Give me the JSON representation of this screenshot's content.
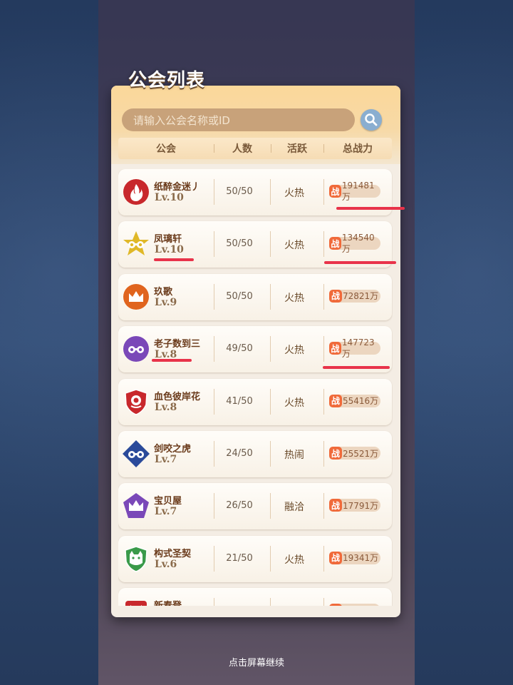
{
  "title": "公会列表",
  "search": {
    "placeholder": "请输入公会名称或ID"
  },
  "headers": {
    "guild": "公会",
    "members": "人数",
    "activity": "活跃",
    "power": "总战力"
  },
  "power_badge": "战",
  "guilds": [
    {
      "name": "纸醉金迷丿",
      "level": "Lv.10",
      "members": "50/50",
      "activity": "火热",
      "power": "191481万",
      "emblem": "flame-emblem-icon",
      "color": "#c8282c"
    },
    {
      "name": "凤璃轩",
      "level": "Lv.10",
      "members": "50/50",
      "activity": "火热",
      "power": "134540万",
      "emblem": "goggles-star-emblem-icon",
      "color": "#e0b828"
    },
    {
      "name": "玖歌",
      "level": "Lv.9",
      "members": "50/50",
      "activity": "火热",
      "power": "72821万",
      "emblem": "crown-emblem-icon",
      "color": "#e0641e"
    },
    {
      "name": "老子数到三",
      "level": "Lv.8",
      "members": "49/50",
      "activity": "火热",
      "power": "147723万",
      "emblem": "goggles-emblem-icon",
      "color": "#7a48b8"
    },
    {
      "name": "血色彼岸花",
      "level": "Lv.8",
      "members": "41/50",
      "activity": "火热",
      "power": "55416万",
      "emblem": "rose-shield-emblem-icon",
      "color": "#c8282c"
    },
    {
      "name": "剑咬之虎",
      "level": "Lv.7",
      "members": "24/50",
      "activity": "热闹",
      "power": "25521万",
      "emblem": "goggles-diamond-emblem-icon",
      "color": "#2a4a9a"
    },
    {
      "name": "宝贝屋",
      "level": "Lv.7",
      "members": "26/50",
      "activity": "融洽",
      "power": "17791万",
      "emblem": "crown-pentagon-emblem-icon",
      "color": "#7a48b8"
    },
    {
      "name": "构式圣契",
      "level": "Lv.6",
      "members": "21/50",
      "activity": "火热",
      "power": "19341万",
      "emblem": "cat-shield-emblem-icon",
      "color": "#3a9a4a"
    },
    {
      "name": "新春登",
      "level": "",
      "members": "",
      "activity": "",
      "power": "",
      "emblem": "ribbon-emblem-icon",
      "color": "#c8282c"
    }
  ],
  "footer_hint": "点击屏幕继续",
  "colors": {
    "accent": "#f06a3a",
    "annotation": "#e8334a",
    "panel": "#f4ede4"
  }
}
